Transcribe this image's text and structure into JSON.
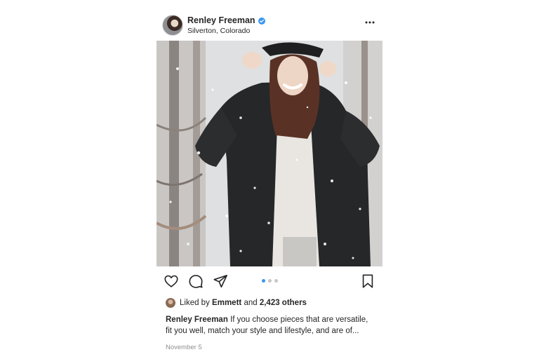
{
  "post": {
    "username": "Renley Freeman",
    "location": "Silverton, Colorado",
    "likes": {
      "prefix": "Liked by",
      "user": "Emmett",
      "connector": "and",
      "others": "2,423 others"
    },
    "caption": {
      "username": "Renley Freeman",
      "text": "If you choose pieces that are versatile, fit you well, match your style and lifestyle, and are of..."
    },
    "date": "November 5",
    "carousel": {
      "total": 3,
      "active_index": 0
    }
  },
  "icons": {
    "verified": "verified-badge-icon",
    "more": "more-options-icon",
    "like": "heart-icon",
    "comment": "comment-icon",
    "share": "paper-plane-icon",
    "save": "bookmark-icon"
  },
  "colors": {
    "verified": "#3897f0",
    "active_dot": "#3897f0",
    "inactive_dot": "#c7c7c7",
    "muted_text": "#8e8e8e",
    "text": "#262626"
  }
}
